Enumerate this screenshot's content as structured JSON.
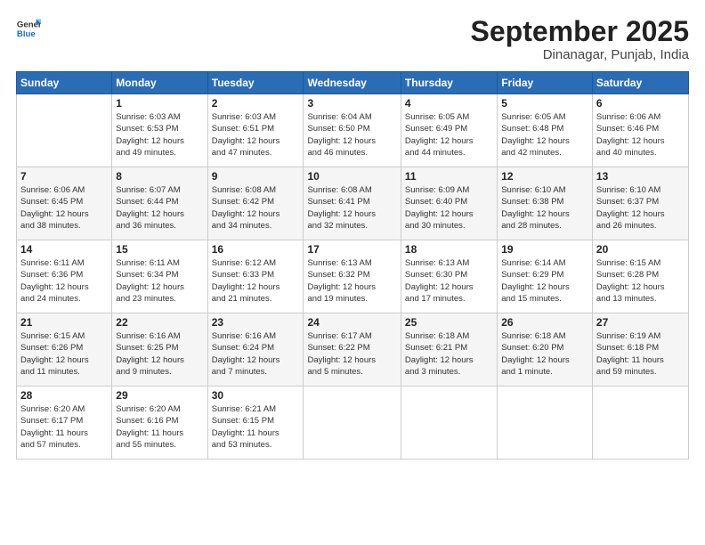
{
  "logo": {
    "line1": "General",
    "line2": "Blue"
  },
  "title": "September 2025",
  "location": "Dinanagar, Punjab, India",
  "header_days": [
    "Sunday",
    "Monday",
    "Tuesday",
    "Wednesday",
    "Thursday",
    "Friday",
    "Saturday"
  ],
  "weeks": [
    [
      {
        "day": "",
        "info": ""
      },
      {
        "day": "1",
        "info": "Sunrise: 6:03 AM\nSunset: 6:53 PM\nDaylight: 12 hours\nand 49 minutes."
      },
      {
        "day": "2",
        "info": "Sunrise: 6:03 AM\nSunset: 6:51 PM\nDaylight: 12 hours\nand 47 minutes."
      },
      {
        "day": "3",
        "info": "Sunrise: 6:04 AM\nSunset: 6:50 PM\nDaylight: 12 hours\nand 46 minutes."
      },
      {
        "day": "4",
        "info": "Sunrise: 6:05 AM\nSunset: 6:49 PM\nDaylight: 12 hours\nand 44 minutes."
      },
      {
        "day": "5",
        "info": "Sunrise: 6:05 AM\nSunset: 6:48 PM\nDaylight: 12 hours\nand 42 minutes."
      },
      {
        "day": "6",
        "info": "Sunrise: 6:06 AM\nSunset: 6:46 PM\nDaylight: 12 hours\nand 40 minutes."
      }
    ],
    [
      {
        "day": "7",
        "info": "Sunrise: 6:06 AM\nSunset: 6:45 PM\nDaylight: 12 hours\nand 38 minutes."
      },
      {
        "day": "8",
        "info": "Sunrise: 6:07 AM\nSunset: 6:44 PM\nDaylight: 12 hours\nand 36 minutes."
      },
      {
        "day": "9",
        "info": "Sunrise: 6:08 AM\nSunset: 6:42 PM\nDaylight: 12 hours\nand 34 minutes."
      },
      {
        "day": "10",
        "info": "Sunrise: 6:08 AM\nSunset: 6:41 PM\nDaylight: 12 hours\nand 32 minutes."
      },
      {
        "day": "11",
        "info": "Sunrise: 6:09 AM\nSunset: 6:40 PM\nDaylight: 12 hours\nand 30 minutes."
      },
      {
        "day": "12",
        "info": "Sunrise: 6:10 AM\nSunset: 6:38 PM\nDaylight: 12 hours\nand 28 minutes."
      },
      {
        "day": "13",
        "info": "Sunrise: 6:10 AM\nSunset: 6:37 PM\nDaylight: 12 hours\nand 26 minutes."
      }
    ],
    [
      {
        "day": "14",
        "info": "Sunrise: 6:11 AM\nSunset: 6:36 PM\nDaylight: 12 hours\nand 24 minutes."
      },
      {
        "day": "15",
        "info": "Sunrise: 6:11 AM\nSunset: 6:34 PM\nDaylight: 12 hours\nand 23 minutes."
      },
      {
        "day": "16",
        "info": "Sunrise: 6:12 AM\nSunset: 6:33 PM\nDaylight: 12 hours\nand 21 minutes."
      },
      {
        "day": "17",
        "info": "Sunrise: 6:13 AM\nSunset: 6:32 PM\nDaylight: 12 hours\nand 19 minutes."
      },
      {
        "day": "18",
        "info": "Sunrise: 6:13 AM\nSunset: 6:30 PM\nDaylight: 12 hours\nand 17 minutes."
      },
      {
        "day": "19",
        "info": "Sunrise: 6:14 AM\nSunset: 6:29 PM\nDaylight: 12 hours\nand 15 minutes."
      },
      {
        "day": "20",
        "info": "Sunrise: 6:15 AM\nSunset: 6:28 PM\nDaylight: 12 hours\nand 13 minutes."
      }
    ],
    [
      {
        "day": "21",
        "info": "Sunrise: 6:15 AM\nSunset: 6:26 PM\nDaylight: 12 hours\nand 11 minutes."
      },
      {
        "day": "22",
        "info": "Sunrise: 6:16 AM\nSunset: 6:25 PM\nDaylight: 12 hours\nand 9 minutes."
      },
      {
        "day": "23",
        "info": "Sunrise: 6:16 AM\nSunset: 6:24 PM\nDaylight: 12 hours\nand 7 minutes."
      },
      {
        "day": "24",
        "info": "Sunrise: 6:17 AM\nSunset: 6:22 PM\nDaylight: 12 hours\nand 5 minutes."
      },
      {
        "day": "25",
        "info": "Sunrise: 6:18 AM\nSunset: 6:21 PM\nDaylight: 12 hours\nand 3 minutes."
      },
      {
        "day": "26",
        "info": "Sunrise: 6:18 AM\nSunset: 6:20 PM\nDaylight: 12 hours\nand 1 minute."
      },
      {
        "day": "27",
        "info": "Sunrise: 6:19 AM\nSunset: 6:18 PM\nDaylight: 11 hours\nand 59 minutes."
      }
    ],
    [
      {
        "day": "28",
        "info": "Sunrise: 6:20 AM\nSunset: 6:17 PM\nDaylight: 11 hours\nand 57 minutes."
      },
      {
        "day": "29",
        "info": "Sunrise: 6:20 AM\nSunset: 6:16 PM\nDaylight: 11 hours\nand 55 minutes."
      },
      {
        "day": "30",
        "info": "Sunrise: 6:21 AM\nSunset: 6:15 PM\nDaylight: 11 hours\nand 53 minutes."
      },
      {
        "day": "",
        "info": ""
      },
      {
        "day": "",
        "info": ""
      },
      {
        "day": "",
        "info": ""
      },
      {
        "day": "",
        "info": ""
      }
    ]
  ]
}
